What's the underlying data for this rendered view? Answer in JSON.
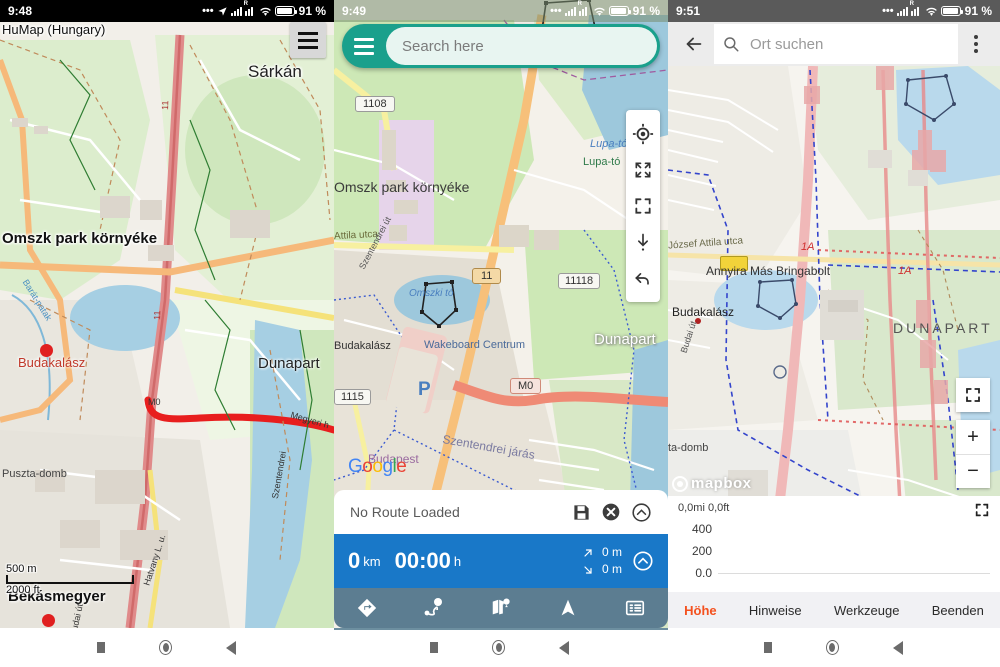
{
  "panels": [
    {
      "id": "humap",
      "statusbar": {
        "time": "9:48",
        "battery": "91 %",
        "roaming_label": "R"
      },
      "title": "HuMap (Hungary)",
      "menu_icon": "hamburger-icon",
      "scale": {
        "metric": "500 m",
        "imperial": "2000 ft"
      },
      "map_labels": [
        "Sárkán",
        "Omszk park környéke",
        "Budakalász",
        "Dunapart",
        "Békásmegyer",
        "Puszta-domb",
        "Barát-patak",
        "Budai út",
        "Szentendrei",
        "Hatvany L. u.",
        "Megyeri h",
        "M0",
        "11"
      ]
    },
    {
      "id": "locus-google",
      "statusbar": {
        "time": "9:49",
        "battery": "91 %",
        "roaming_label": "R"
      },
      "search": {
        "placeholder": "Search here",
        "menu_icon": "hamburger-icon"
      },
      "map_controls": [
        {
          "name": "my-location-icon"
        },
        {
          "name": "expand-arrows-icon"
        },
        {
          "name": "center-frame-icon"
        },
        {
          "name": "download-arrow-icon"
        },
        {
          "name": "undo-arrow-icon"
        }
      ],
      "attribution": "Google",
      "map_labels": [
        "1108",
        "Omszk park környéke",
        "Attila utca",
        "Lupa-tó",
        "11",
        "11118",
        "Omszki tó",
        "Wakeboard Centrum",
        "Dunapart",
        "M0",
        "1115",
        "Budapest",
        "Szentendrei járás",
        "Budakalász",
        "Szentendrei út",
        "P"
      ],
      "route_panel": {
        "status": "No Route Loaded",
        "save_icon": "save-icon",
        "close_icon": "close-circle-icon",
        "collapse_icon": "chevron-up-circle-icon",
        "distance_value": "0",
        "distance_unit": "km",
        "time_value": "00:00",
        "time_unit": "h",
        "ascent": "0 m",
        "descent": "0 m",
        "expand_icon": "chevron-up-circle-icon",
        "actions": [
          {
            "name": "navigate-diamond-icon"
          },
          {
            "name": "route-points-icon"
          },
          {
            "name": "map-pin-icon"
          },
          {
            "name": "compass-arrow-icon"
          },
          {
            "name": "list-icon"
          }
        ]
      }
    },
    {
      "id": "mapbox-german",
      "statusbar": {
        "time": "9:51",
        "battery": "91 %",
        "roaming_label": "R"
      },
      "appbar": {
        "back_icon": "arrow-left-icon",
        "search_icon": "search-icon",
        "search_placeholder": "Ort suchen",
        "overflow_icon": "kebab-menu-icon"
      },
      "zoom_controls": {
        "fullscreen_icon": "center-frame-icon",
        "zoom_in": "+",
        "zoom_out": "−"
      },
      "attribution": "mapbox",
      "map_labels": [
        "József Attila utca",
        "Annyira Más Bringabolt",
        "Budakalász",
        "DUNAPART",
        "Budai út",
        "1A",
        "ta-domb"
      ],
      "elevation": {
        "readout": "0,0mi 0,0ft",
        "expand_icon": "center-frame-icon",
        "y_ticks": [
          "400",
          "200",
          "0.0"
        ]
      },
      "tabs": [
        {
          "label": "Höhe",
          "active": true
        },
        {
          "label": "Hinweise",
          "active": false
        },
        {
          "label": "Werkzeuge",
          "active": false
        },
        {
          "label": "Beenden",
          "active": false
        }
      ]
    }
  ],
  "navbar": {
    "buttons": [
      {
        "name": "recents-button"
      },
      {
        "name": "home-button"
      },
      {
        "name": "back-button"
      }
    ]
  },
  "colors": {
    "teal": "#1aa08c",
    "blue": "#1978c8",
    "slate": "#5c7d91",
    "orange_accent": "#f4511e"
  }
}
